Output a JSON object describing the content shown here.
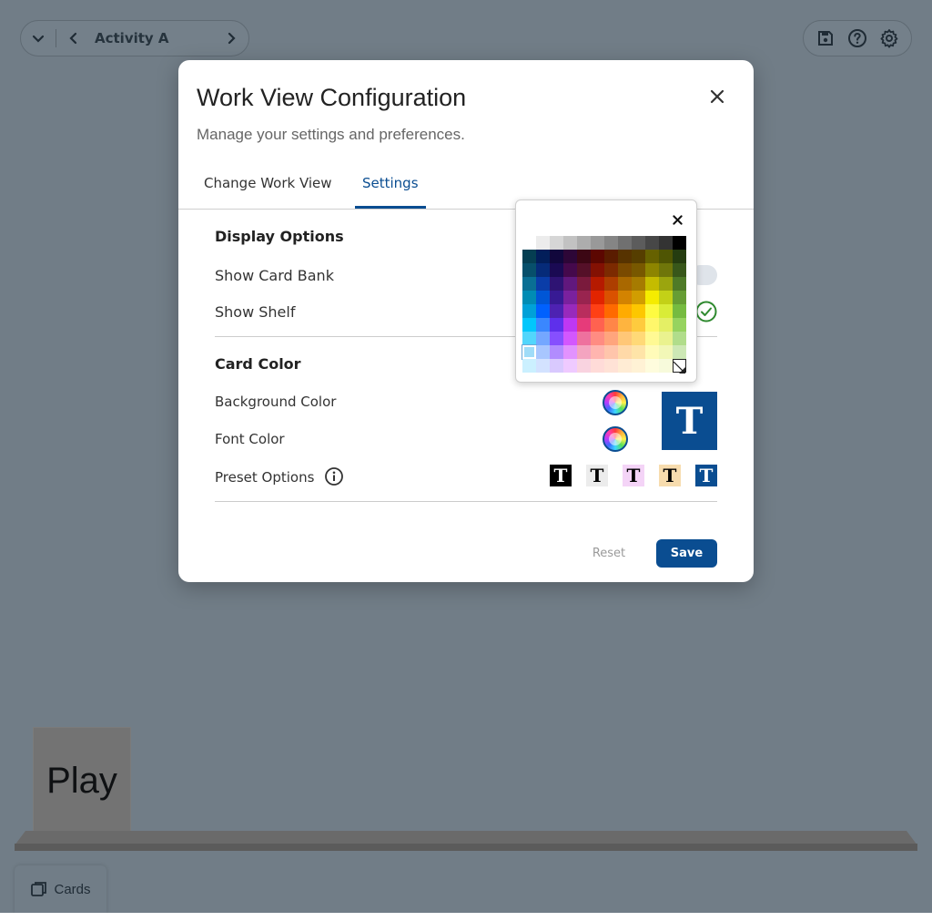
{
  "topbar": {
    "activity_title": "Activity A",
    "dropdown_icon": "chevron-down-icon",
    "prev_icon": "chevron-left-icon",
    "next_icon": "chevron-right-icon",
    "tools": [
      "save-icon",
      "help-icon",
      "gear-icon"
    ]
  },
  "modal": {
    "title": "Work View Configuration",
    "subtitle": "Manage your settings and preferences.",
    "tabs": [
      {
        "label": "Change Work View",
        "active": false
      },
      {
        "label": "Settings",
        "active": true
      }
    ],
    "display_options": {
      "heading": "Display Options",
      "show_card_bank": {
        "label": "Show Card Bank",
        "enabled": false
      },
      "show_shelf": {
        "label": "Show Shelf",
        "enabled": true
      }
    },
    "card_color": {
      "heading": "Card Color",
      "background_color_label": "Background Color",
      "font_color_label": "Font Color",
      "preset_options_label": "Preset Options",
      "preview_letter": "T",
      "preview_bg": "#0a4d91",
      "preview_fg": "#ffffff",
      "presets": [
        {
          "letter": "T",
          "bg": "#000000",
          "fg": "#ffffff"
        },
        {
          "letter": "T",
          "bg": "#ececec",
          "fg": "#000000"
        },
        {
          "letter": "T",
          "bg": "#f4d4f7",
          "fg": "#000000"
        },
        {
          "letter": "T",
          "bg": "#f7dcae",
          "fg": "#000000"
        },
        {
          "letter": "T",
          "bg": "#0a4d91",
          "fg": "#ffffff"
        }
      ]
    },
    "buttons": {
      "reset": "Reset",
      "save": "Save"
    }
  },
  "color_picker": {
    "selected": "#9fdcf8",
    "grid": [
      [
        "#ffffff",
        "#ececec",
        "#d6d6d6",
        "#c2c2c2",
        "#adadad",
        "#999999",
        "#858585",
        "#707070",
        "#5c5c5c",
        "#474747",
        "#333333",
        "#000000"
      ],
      [
        "#053e52",
        "#021e5a",
        "#11073c",
        "#2d0637",
        "#3c0714",
        "#5c0701",
        "#5a1c00",
        "#573300",
        "#563e00",
        "#666100",
        "#4f5503",
        "#253c10"
      ],
      [
        "#074f6b",
        "#062b79",
        "#1a0a53",
        "#45094c",
        "#551028",
        "#831103",
        "#7c2a01",
        "#7a4a00",
        "#785800",
        "#8d8500",
        "#6f760a",
        "#38571a"
      ],
      [
        "#0a6f94",
        "#0a3da8",
        "#2e1373",
        "#61187d",
        "#7a1a3c",
        "#b51a00",
        "#ad3e00",
        "#a96800",
        "#a67b01",
        "#c5bc00",
        "#9ba50e",
        "#4e7a27"
      ],
      [
        "#008cb4",
        "#0056d6",
        "#371a94",
        "#7a219e",
        "#99244f",
        "#e22400",
        "#da5100",
        "#d38301",
        "#d19d01",
        "#f5ec00",
        "#c3d117",
        "#669d34"
      ],
      [
        "#00a1d8",
        "#0061fe",
        "#4d22b2",
        "#982abc",
        "#b92d5d",
        "#ff4015",
        "#ff6a00",
        "#ffab01",
        "#fdc700",
        "#fefb41",
        "#d9ec37",
        "#76bb40"
      ],
      [
        "#01c7fc",
        "#3a87fe",
        "#5e30eb",
        "#be38f3",
        "#e63b7a",
        "#ff6250",
        "#ff8648",
        "#feb43f",
        "#fecb3e",
        "#fff76b",
        "#e4ef65",
        "#96d35f"
      ],
      [
        "#52d6fc",
        "#74a7ff",
        "#864ffe",
        "#d357fe",
        "#ee719e",
        "#ff8c82",
        "#ffa57d",
        "#ffc777",
        "#ffd977",
        "#fff994",
        "#eaf28f",
        "#b1dd8b"
      ],
      [
        "#9fdcf8",
        "#a8c6fe",
        "#b18cfe",
        "#e292fe",
        "#f4a4c0",
        "#ffb5af",
        "#ffc5ab",
        "#ffd9a8",
        "#fee4a8",
        "#fffbb9",
        "#f2f7b7",
        "#cde8b5"
      ],
      [
        "#cbf0ff",
        "#d3e2ff",
        "#d9c9fe",
        "#efcaff",
        "#f9d3e0",
        "#ffdbd8",
        "#ffe2d6",
        "#ffecd4",
        "#fff2d5",
        "#fefcdd",
        "#f7fadb",
        "#dfeed4"
      ]
    ]
  },
  "bottom": {
    "play_card_text": "Play",
    "cards_button_label": "Cards"
  }
}
